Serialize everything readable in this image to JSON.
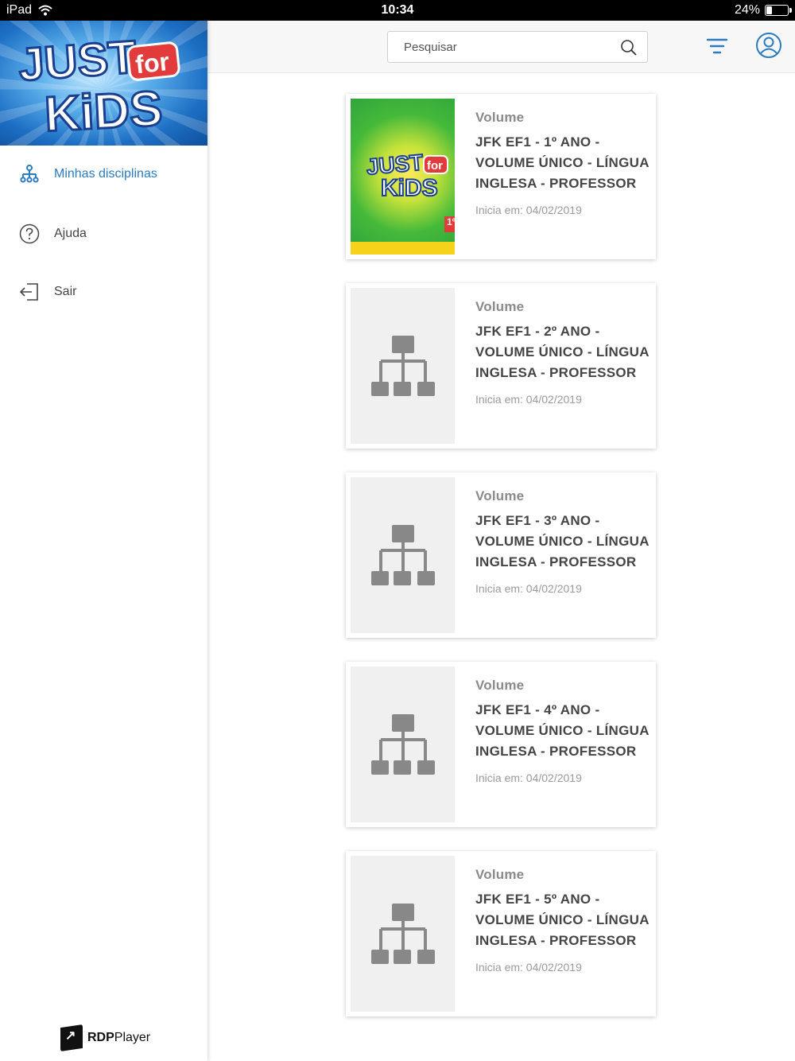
{
  "status_bar": {
    "device": "iPad",
    "time": "10:34",
    "battery": "24%",
    "battery_level": 0.24
  },
  "sidebar": {
    "items": [
      {
        "label": "Minhas disciplinas",
        "icon": "hierarchy-icon",
        "active": true
      },
      {
        "label": "Ajuda",
        "icon": "help-circle-icon",
        "active": false
      },
      {
        "label": "Sair",
        "icon": "logout-icon",
        "active": false
      }
    ],
    "footer": {
      "brand_bold": "RDP",
      "brand_rest": "Player"
    },
    "logo_text": "JUST for KIDS"
  },
  "header": {
    "search_placeholder": "Pesquisar"
  },
  "cards": [
    {
      "type": "Volume",
      "title": "JFK EF1 - 1º ANO - VOLUME ÚNICO - LÍNGUA INGLESA - PROFESSOR",
      "date": "Inicia em: 04/02/2019",
      "cover_text": "JUST for KIDS",
      "cover_badge": "1º"
    },
    {
      "type": "Volume",
      "title": "JFK EF1 - 2º ANO - VOLUME ÚNICO - LÍNGUA INGLESA - PROFESSOR",
      "date": "Inicia em: 04/02/2019"
    },
    {
      "type": "Volume",
      "title": "JFK EF1 - 3º ANO - VOLUME ÚNICO - LÍNGUA INGLESA - PROFESSOR",
      "date": "Inicia em: 04/02/2019"
    },
    {
      "type": "Volume",
      "title": "JFK EF1 - 4º ANO - VOLUME ÚNICO - LÍNGUA INGLESA - PROFESSOR",
      "date": "Inicia em: 04/02/2019"
    },
    {
      "type": "Volume",
      "title": "JFK EF1 - 5º ANO - VOLUME ÚNICO - LÍNGUA INGLESA - PROFESSOR",
      "date": "Inicia em: 04/02/2019"
    }
  ],
  "colors": {
    "accent": "#2a7bc0",
    "placeholder_icon": "#888888"
  }
}
